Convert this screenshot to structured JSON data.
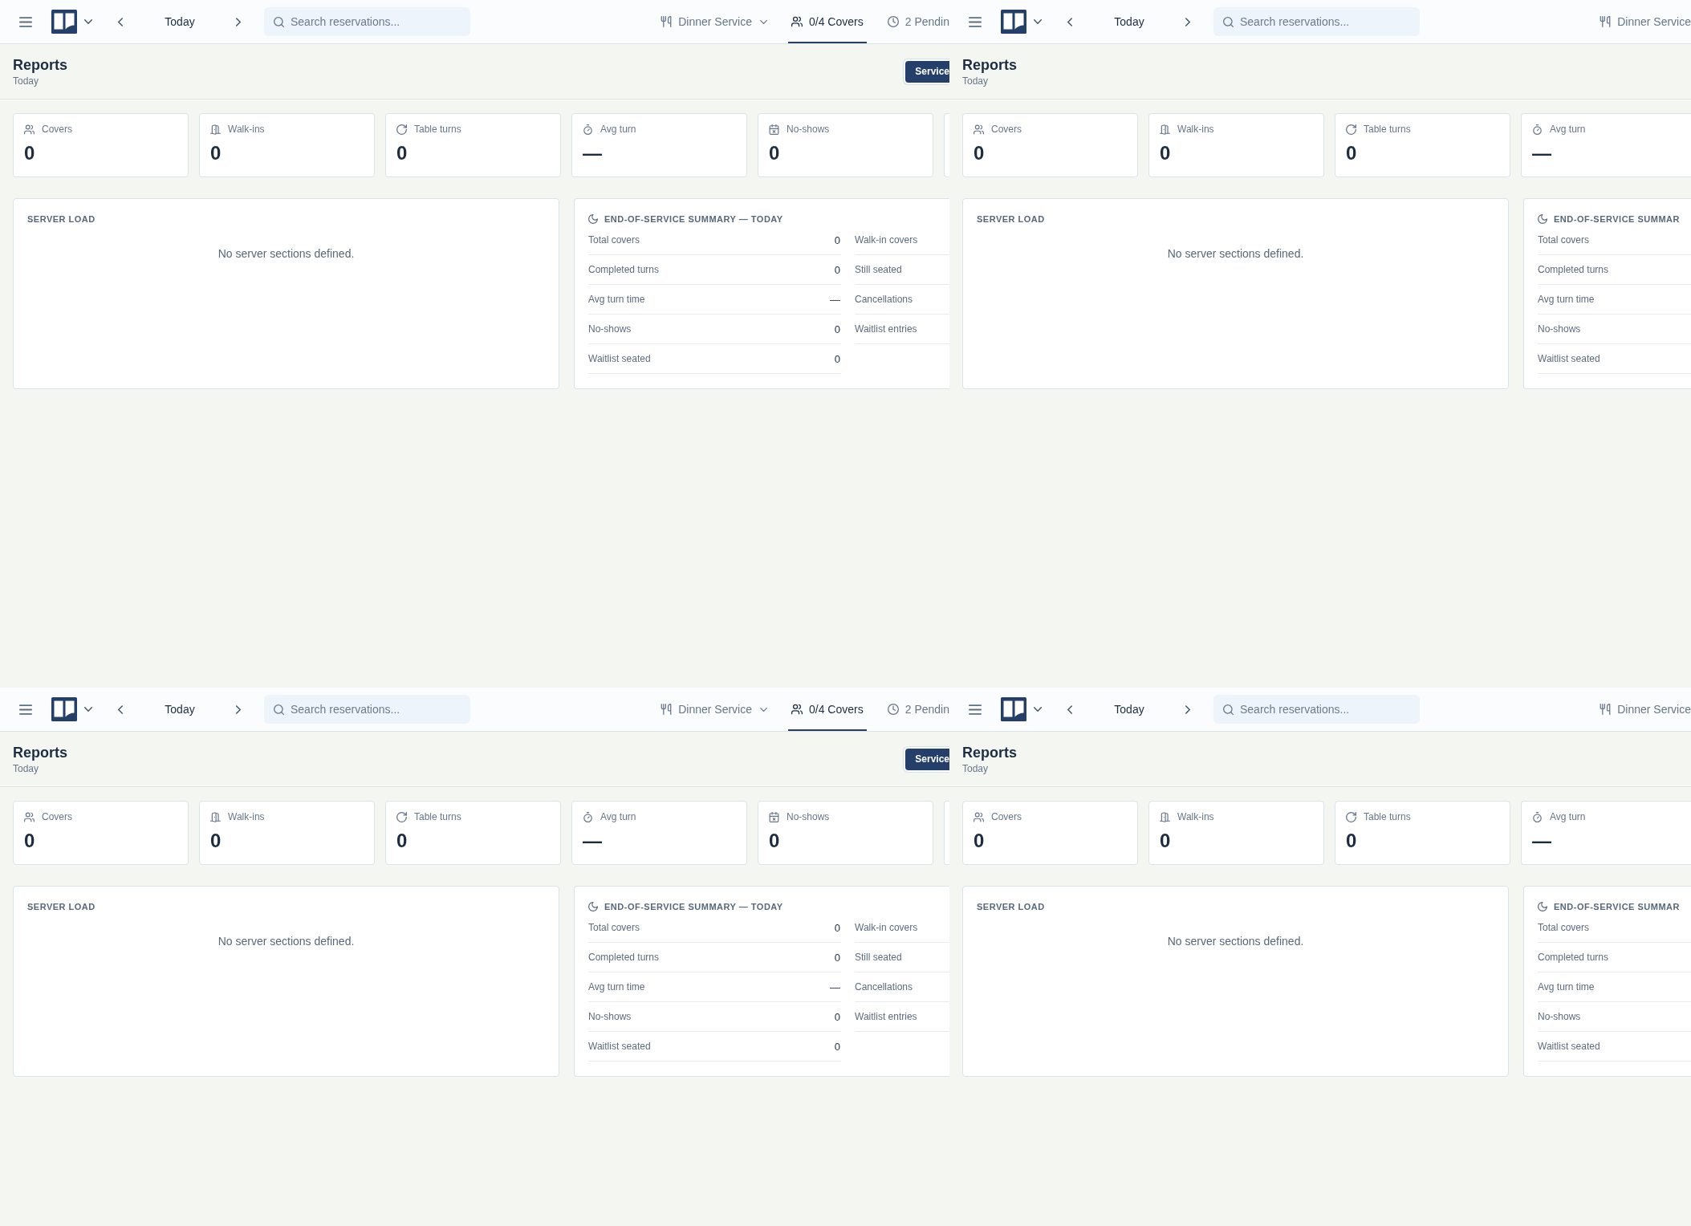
{
  "tiles": [
    {
      "topbar": {
        "date": "Today",
        "search": {
          "placeholder": "Search reservations..."
        },
        "items": [
          {
            "label": "Dinner Service",
            "dropdown": true,
            "selected": false
          },
          {
            "label": "0/4 Covers",
            "dropdown": false,
            "selected": true
          },
          {
            "label": "2 Pendin",
            "dropdown": false,
            "selected": false
          }
        ]
      },
      "page_header": {
        "title": "Reports",
        "subtitle": "Today",
        "view_toggle": [
          {
            "label": "Service",
            "selected": true
          }
        ]
      },
      "stats": [
        {
          "kind": "metric",
          "label": "Covers",
          "value": "0"
        },
        {
          "kind": "metric",
          "label": "Walk-ins",
          "value": "0"
        },
        {
          "kind": "metric",
          "label": "Table turns",
          "value": "0"
        },
        {
          "kind": "metric",
          "label": "Avg turn",
          "value": "—"
        },
        {
          "kind": "metric",
          "label": "No-shows",
          "value": "0"
        },
        {
          "kind": "sliver"
        }
      ],
      "server_load": {
        "title": "SERVER LOAD",
        "empty_message": "No server sections defined."
      },
      "summary": {
        "title": "END-OF-SERVICE SUMMARY — TODAY",
        "columns": [
          {
            "rows": [
              {
                "label": "Total covers",
                "value": "0"
              },
              {
                "label": "Completed turns",
                "value": "0"
              },
              {
                "label": "Avg turn time",
                "value": "—"
              },
              {
                "label": "No-shows",
                "value": "0"
              },
              {
                "label": "Waitlist seated",
                "value": "0"
              }
            ]
          },
          {
            "rows": [
              {
                "label": "Walk-in covers"
              },
              {
                "label": "Still seated"
              },
              {
                "label": "Cancellations"
              },
              {
                "label": "Waitlist entries"
              }
            ]
          }
        ]
      }
    },
    {
      "topbar": {
        "date": "Today",
        "search": {
          "placeholder": "Search reservations..."
        },
        "items": [
          {
            "label": "Dinner Service",
            "dropdown": false,
            "selected": false
          }
        ]
      },
      "page_header": {
        "title": "Reports",
        "subtitle": "Today"
      },
      "stats": [
        {
          "kind": "metric",
          "label": "Covers",
          "value": "0"
        },
        {
          "kind": "metric",
          "label": "Walk-ins",
          "value": "0"
        },
        {
          "kind": "metric",
          "label": "Table turns",
          "value": "0"
        },
        {
          "kind": "metric",
          "label": "Avg turn",
          "value": "—"
        }
      ],
      "server_load": {
        "title": "SERVER LOAD",
        "empty_message": "No server sections defined."
      },
      "summary": {
        "title": "END-OF-SERVICE SUMMAR",
        "columns": [
          {
            "rows": [
              {
                "label": "Total covers"
              },
              {
                "label": "Completed turns"
              },
              {
                "label": "Avg turn time"
              },
              {
                "label": "No-shows"
              },
              {
                "label": "Waitlist seated"
              }
            ]
          }
        ]
      }
    },
    {
      "topbar": {
        "date": "Today",
        "search": {
          "placeholder": "Search reservations..."
        },
        "items": [
          {
            "label": "Dinner Service",
            "dropdown": true,
            "selected": false
          },
          {
            "label": "0/4 Covers",
            "dropdown": false,
            "selected": true
          },
          {
            "label": "2 Pendin",
            "dropdown": false,
            "selected": false
          }
        ]
      },
      "page_header": {
        "title": "Reports",
        "subtitle": "Today",
        "view_toggle": [
          {
            "label": "Service",
            "selected": true
          }
        ]
      },
      "stats": [
        {
          "kind": "metric",
          "label": "Covers",
          "value": "0"
        },
        {
          "kind": "metric",
          "label": "Walk-ins",
          "value": "0"
        },
        {
          "kind": "metric",
          "label": "Table turns",
          "value": "0"
        },
        {
          "kind": "metric",
          "label": "Avg turn",
          "value": "—"
        },
        {
          "kind": "metric",
          "label": "No-shows",
          "value": "0"
        },
        {
          "kind": "sliver"
        }
      ],
      "server_load": {
        "title": "SERVER LOAD",
        "empty_message": "No server sections defined."
      },
      "summary": {
        "title": "END-OF-SERVICE SUMMARY — TODAY",
        "columns": [
          {
            "rows": [
              {
                "label": "Total covers",
                "value": "0"
              },
              {
                "label": "Completed turns",
                "value": "0"
              },
              {
                "label": "Avg turn time",
                "value": "—"
              },
              {
                "label": "No-shows",
                "value": "0"
              },
              {
                "label": "Waitlist seated",
                "value": "0"
              }
            ]
          },
          {
            "rows": [
              {
                "label": "Walk-in covers"
              },
              {
                "label": "Still seated"
              },
              {
                "label": "Cancellations"
              },
              {
                "label": "Waitlist entries"
              }
            ]
          }
        ]
      }
    },
    {
      "topbar": {
        "date": "Today",
        "search": {
          "placeholder": "Search reservations..."
        },
        "items": [
          {
            "label": "Dinner Service",
            "dropdown": false,
            "selected": false
          }
        ]
      },
      "page_header": {
        "title": "Reports",
        "subtitle": "Today"
      },
      "stats": [
        {
          "kind": "metric",
          "label": "Covers",
          "value": "0"
        },
        {
          "kind": "metric",
          "label": "Walk-ins",
          "value": "0"
        },
        {
          "kind": "metric",
          "label": "Table turns",
          "value": "0"
        },
        {
          "kind": "metric",
          "label": "Avg turn",
          "value": "—"
        }
      ],
      "server_load": {
        "title": "SERVER LOAD",
        "empty_message": "No server sections defined."
      },
      "summary": {
        "title": "END-OF-SERVICE SUMMAR",
        "columns": [
          {
            "rows": [
              {
                "label": "Total covers"
              },
              {
                "label": "Completed turns"
              },
              {
                "label": "Avg turn time"
              },
              {
                "label": "No-shows"
              },
              {
                "label": "Waitlist seated"
              }
            ]
          }
        ]
      }
    }
  ]
}
